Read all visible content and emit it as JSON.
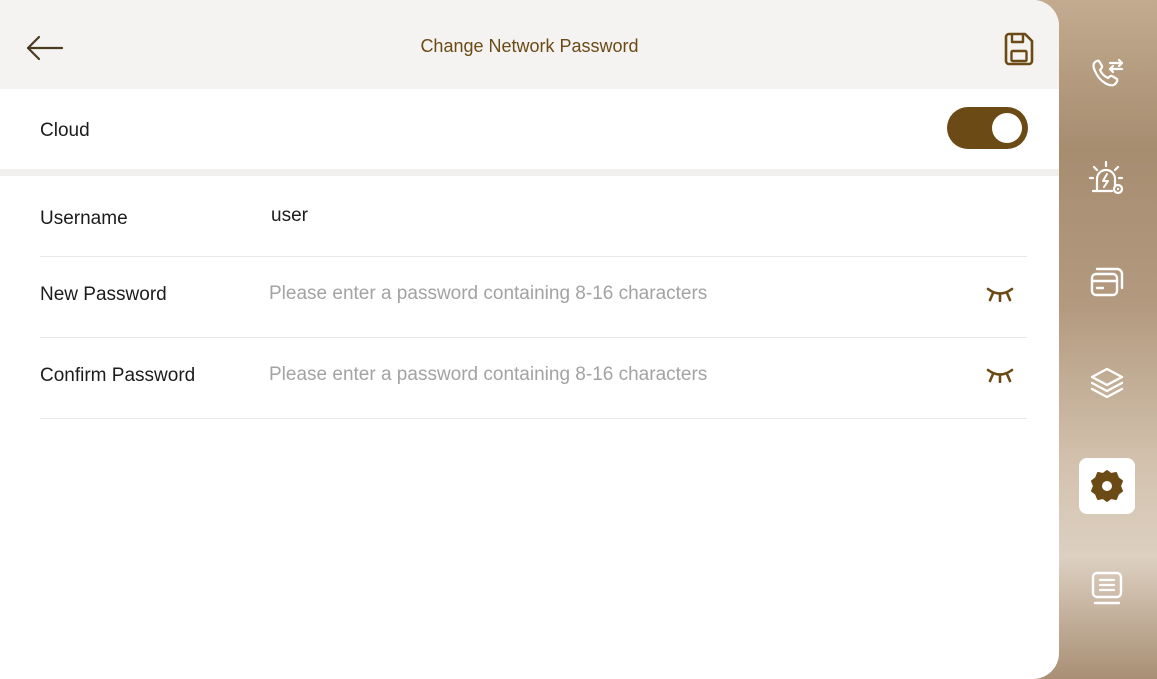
{
  "header": {
    "title": "Change Network Password"
  },
  "cloud": {
    "label": "Cloud",
    "enabled": true
  },
  "form": {
    "username_label": "Username",
    "username_value": "user",
    "new_password_label": "New Password",
    "new_password_placeholder": "Please enter a password containing 8-16 characters",
    "confirm_password_label": "Confirm Password",
    "confirm_password_placeholder": "Please enter a password containing 8-16 characters"
  },
  "sidebar": {
    "items": [
      {
        "icon": "call-settings-icon",
        "active": false
      },
      {
        "icon": "alarm-settings-icon",
        "active": false
      },
      {
        "icon": "access-card-icon",
        "active": false
      },
      {
        "icon": "layers-icon",
        "active": false
      },
      {
        "icon": "gear-icon",
        "active": true
      },
      {
        "icon": "list-icon",
        "active": false
      }
    ]
  },
  "colors": {
    "accent": "#6b4a15",
    "header_bg": "#f4f3f1",
    "placeholder": "#a3a3a3"
  }
}
